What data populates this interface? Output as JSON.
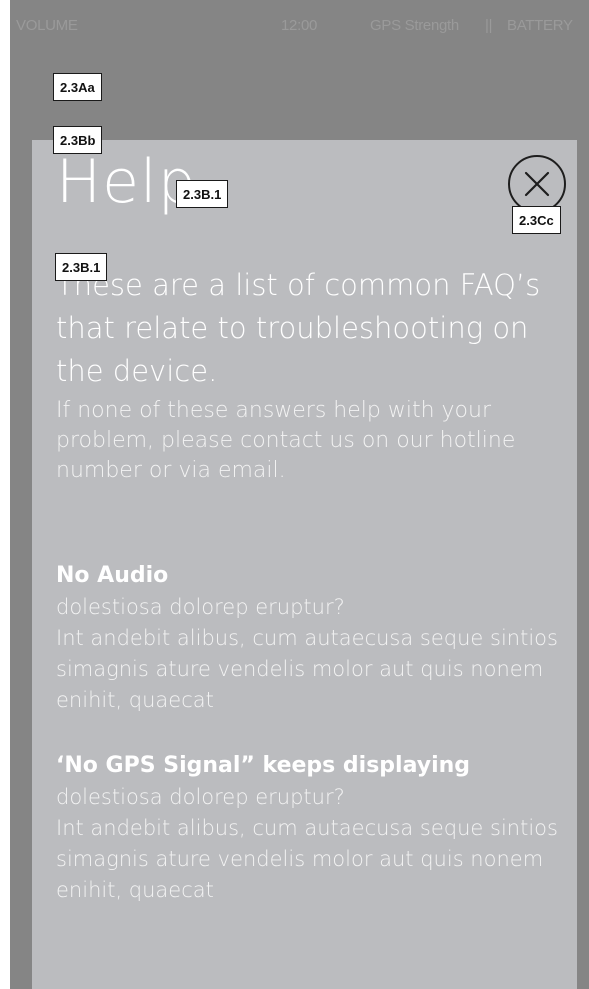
{
  "status_bar": {
    "volume": "VOLUME",
    "time": "12:00",
    "gps": "GPS Strength",
    "separator": "||",
    "battery": "BATTERY"
  },
  "help": {
    "title": "Help",
    "intro": "These are a list of common FAQ’s that relate to troubleshooting on the device.",
    "note": "If none of these answers help with your problem, please contact us on our hotline number or via email.",
    "close_icon": "close-icon"
  },
  "faqs": [
    {
      "question": "No Audio",
      "answer": " dolestiosa dolorep eruptur?\nInt andebit alibus, cum autaecusa seque sintios simagnis ature vendelis molor aut quis nonem enihit, quaecat"
    },
    {
      "question": "‘No GPS Signal” keeps displaying",
      "answer": " dolestiosa dolorep eruptur?\nInt andebit alibus, cum autaecusa seque sintios simagnis ature vendelis molor aut quis nonem enihit, quaecat"
    }
  ],
  "annotations": {
    "a1": "2.3Aa",
    "a2": "2.3Bb",
    "a3": "2.3B.1",
    "a4": "2.3B.1",
    "a5": "2.3Cc"
  },
  "colors": {
    "background": "#858585",
    "panel": "#bbbcbf",
    "text": "#ffffff"
  }
}
